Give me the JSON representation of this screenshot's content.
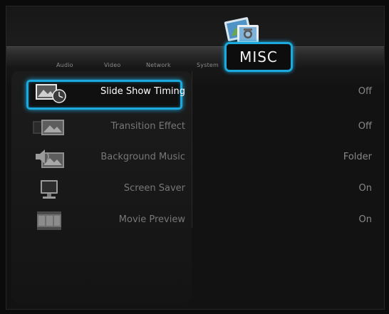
{
  "tabs": [
    {
      "label": "Audio"
    },
    {
      "label": "Video"
    },
    {
      "label": "Network"
    },
    {
      "label": "System"
    }
  ],
  "active_tab": {
    "label": "MISC"
  },
  "settings": [
    {
      "label": "Slide Show Timing",
      "value": "Off",
      "icon": "slideshow-timer-icon",
      "selected": true
    },
    {
      "label": "Transition Effect",
      "value": "Off",
      "icon": "transition-effect-icon",
      "selected": false
    },
    {
      "label": "Background Music",
      "value": "Folder",
      "icon": "background-music-icon",
      "selected": false
    },
    {
      "label": "Screen Saver",
      "value": "On",
      "icon": "monitor-icon",
      "selected": false
    },
    {
      "label": "Movie Preview",
      "value": "On",
      "icon": "film-strip-icon",
      "selected": false
    }
  ],
  "colors": {
    "accent": "#1ba9de",
    "background": "#121212"
  }
}
